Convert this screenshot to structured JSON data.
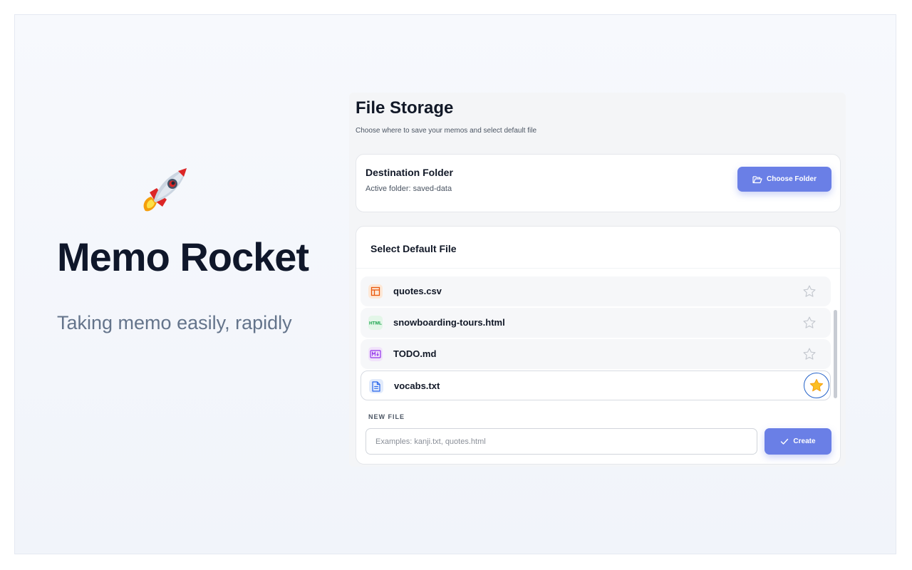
{
  "hero": {
    "app_name": "Memo Rocket",
    "tagline": "Taking memo easily, rapidly",
    "logo_icon": "rocket-icon"
  },
  "panel": {
    "title": "File Storage",
    "subtitle": "Choose where to save your memos and select default file"
  },
  "destination": {
    "title": "Destination Folder",
    "active_folder": "Active folder: saved-data",
    "choose_label": "Choose Folder",
    "choose_icon": "folder-open-icon"
  },
  "files": {
    "title": "Select Default File",
    "items": [
      {
        "name": "quotes.csv",
        "icon": "table-icon",
        "default": false
      },
      {
        "name": "snowboarding-tours.html",
        "icon": "html-icon",
        "default": false
      },
      {
        "name": "TODO.md",
        "icon": "markdown-icon",
        "default": false
      },
      {
        "name": "vocabs.txt",
        "icon": "text-file-icon",
        "default": true
      }
    ]
  },
  "new_file": {
    "label": "NEW FILE",
    "placeholder": "Examples: kanji.txt, quotes.html",
    "value": "",
    "create_label": "Create",
    "create_icon": "check-icon"
  },
  "colors": {
    "accent": "#6a7fe6",
    "star_active": "#fbbf24",
    "star_ring": "#2563c9",
    "title": "#0f172a",
    "tagline": "#64748b"
  }
}
